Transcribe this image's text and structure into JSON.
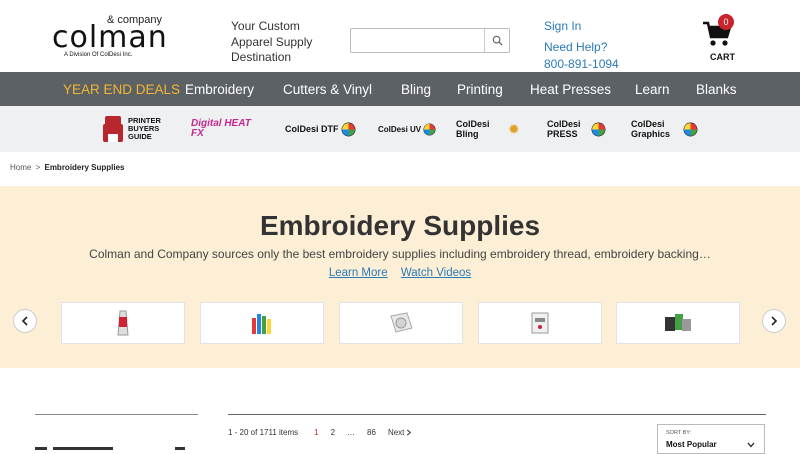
{
  "header": {
    "logo": {
      "amp": "& company",
      "name": "colman",
      "division": "A Division Of ColDesi Inc."
    },
    "tagline": "Your Custom Apparel Supply Destination",
    "search": {
      "placeholder": "",
      "value": ""
    },
    "sign_in": "Sign In",
    "need_help": "Need Help?",
    "phone": "800-891-1094",
    "cart": {
      "count": "0",
      "label": "CART"
    }
  },
  "nav": {
    "items": [
      "YEAR END DEALS",
      "Embroidery",
      "Cutters & Vinyl",
      "Bling",
      "Printing",
      "Heat Presses",
      "Learn",
      "Blanks"
    ]
  },
  "brands": [
    "PRINTER BUYERS GUIDE",
    "Digital HEAT FX",
    "ColDesi DTF",
    "ColDesi UV",
    "ColDesi Bling",
    "ColDesi PRESS",
    "ColDesi Graphics"
  ],
  "breadcrumb": {
    "home": "Home",
    "sep": ">",
    "current": "Embroidery Supplies"
  },
  "hero": {
    "title": "Embroidery Supplies",
    "description": "Colman and Company sources only the best embroidery supplies including embroidery thread, embroidery backing…",
    "learn_more": "Learn More",
    "watch_videos": "Watch Videos"
  },
  "results": {
    "count": "1 - 20 of 1711 items",
    "pages": [
      "1",
      "2",
      "…",
      "86"
    ],
    "next": "Next"
  },
  "sort": {
    "label": "SORT BY:",
    "value": "Most Popular"
  },
  "colors": {
    "nav_bg": "#5c6166",
    "deal": "#f2b632",
    "hero_bg": "#fcefd6",
    "link": "#2a7ab8",
    "badge": "#c8242b"
  }
}
